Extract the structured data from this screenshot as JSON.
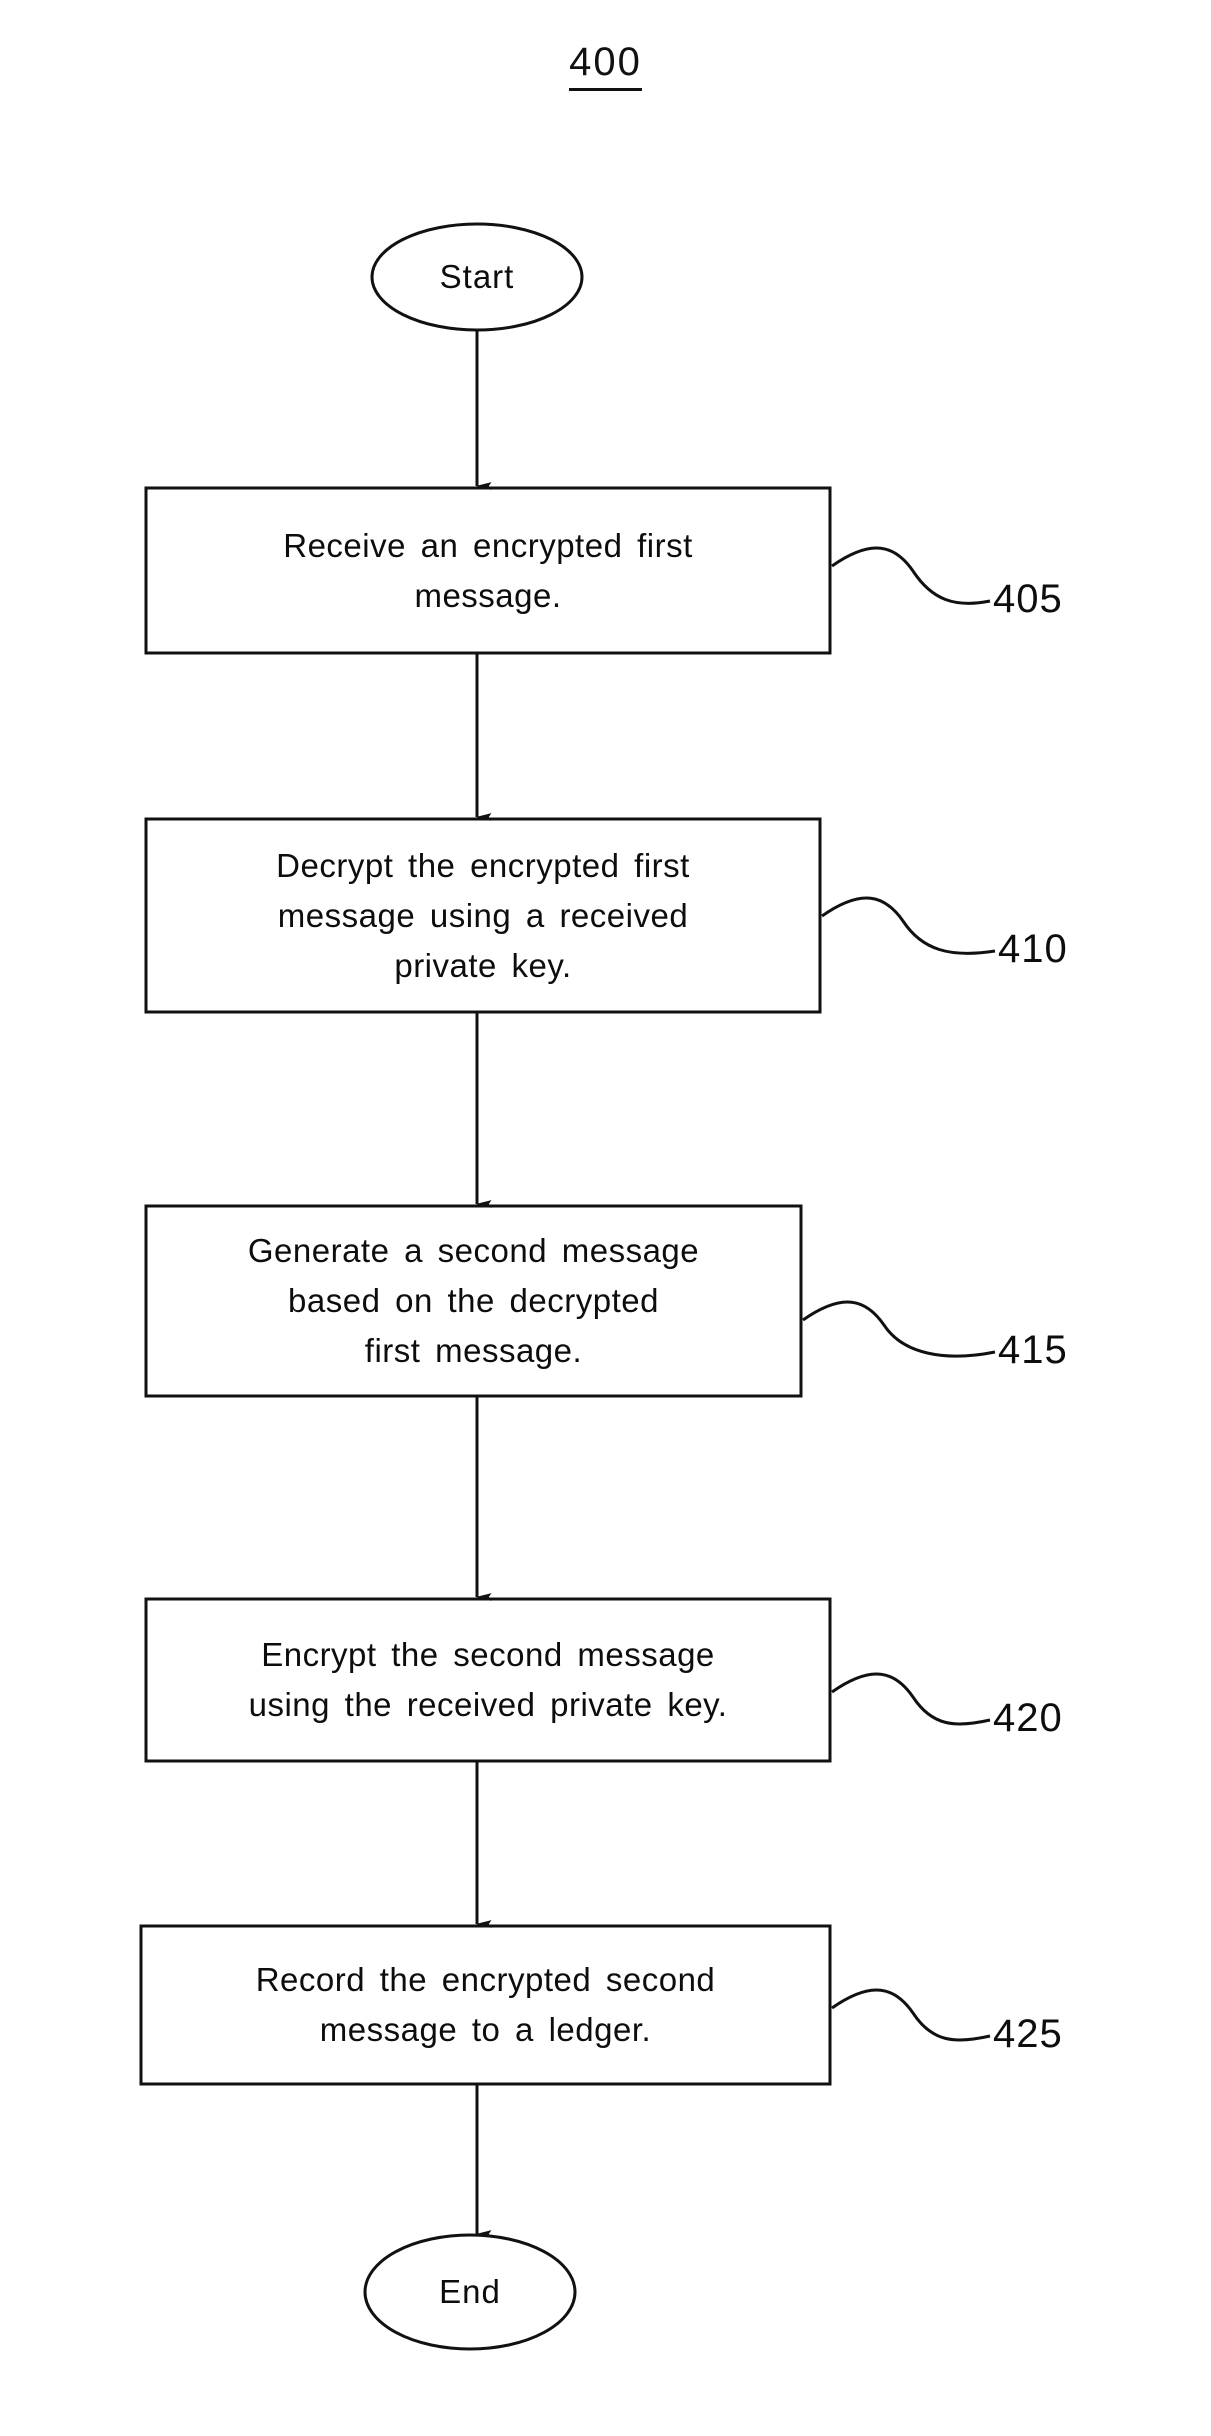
{
  "figure": {
    "number": "400",
    "type": "flowchart",
    "orientation": "vertical-top-to-bottom",
    "line_color": "#111111",
    "background_color": "#ffffff"
  },
  "nodes": [
    {
      "id": "start",
      "shape": "ellipse",
      "label": "Start",
      "ref": ""
    },
    {
      "id": "step-405",
      "shape": "rectangle",
      "label": "Receive an encrypted first\nmessage.",
      "ref": "405"
    },
    {
      "id": "step-410",
      "shape": "rectangle",
      "label": "Decrypt the encrypted first\nmessage using a received\nprivate key.",
      "ref": "410"
    },
    {
      "id": "step-415",
      "shape": "rectangle",
      "label": "Generate a second message\nbased on the decrypted\nfirst message.",
      "ref": "415"
    },
    {
      "id": "step-420",
      "shape": "rectangle",
      "label": "Encrypt the second message\nusing the received private key.",
      "ref": "420"
    },
    {
      "id": "step-425",
      "shape": "rectangle",
      "label": "Record the encrypted second\nmessage to a ledger.",
      "ref": "425"
    },
    {
      "id": "end",
      "shape": "ellipse",
      "label": "End",
      "ref": ""
    }
  ],
  "edges": [
    {
      "from": "start",
      "to": "step-405",
      "style": "arrow-down"
    },
    {
      "from": "step-405",
      "to": "step-410",
      "style": "arrow-down"
    },
    {
      "from": "step-410",
      "to": "step-415",
      "style": "arrow-down"
    },
    {
      "from": "step-415",
      "to": "step-420",
      "style": "arrow-down"
    },
    {
      "from": "step-420",
      "to": "step-425",
      "style": "arrow-down"
    },
    {
      "from": "step-425",
      "to": "end",
      "style": "arrow-down"
    }
  ]
}
